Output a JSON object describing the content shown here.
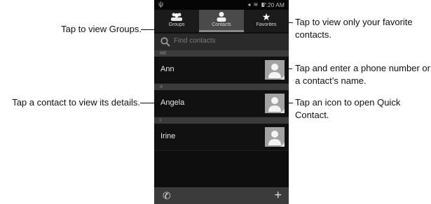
{
  "annotations": {
    "groups": "Tap to view Groups.",
    "favorites": "Tap to view only your favorite contacts.",
    "search": "Tap and enter a phone number or a contact’s name.",
    "contact": "Tap a contact to view its details.",
    "quick_contact": "Tap an icon to open Quick Contact."
  },
  "status_bar": {
    "time": "7:20 AM",
    "left_icon": "usb-icon"
  },
  "tabs": [
    {
      "label": "Groups",
      "icon": "groups-icon"
    },
    {
      "label": "Contacts",
      "icon": "contact-icon",
      "active": true
    },
    {
      "label": "Favorites",
      "icon": "star-icon"
    }
  ],
  "search": {
    "placeholder": "Find contacts"
  },
  "sections": [
    {
      "header": "ME",
      "contacts": [
        {
          "name": "Ann"
        }
      ]
    },
    {
      "header": "A",
      "contacts": [
        {
          "name": "Angela"
        }
      ]
    },
    {
      "header": "I",
      "contacts": [
        {
          "name": "Irine"
        }
      ]
    }
  ],
  "bottom_bar": {
    "left_icon": "phone-icon",
    "right_icon": "plus-icon"
  },
  "colors": {
    "screen_bg": "#0e0e0e",
    "tab_active": "#4a4a4a",
    "section_header": "#3b3b3b"
  }
}
